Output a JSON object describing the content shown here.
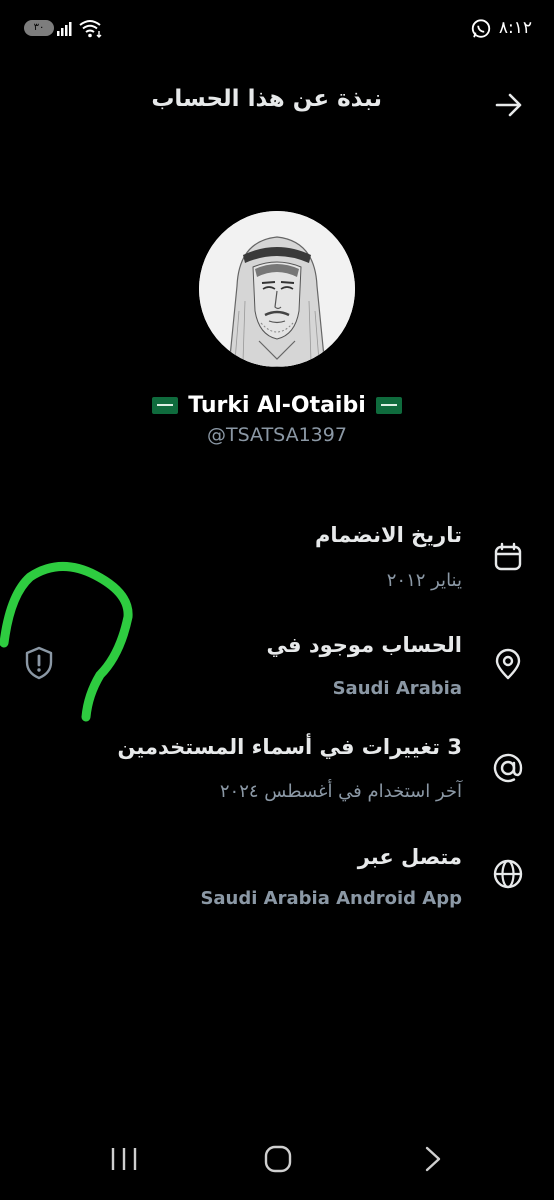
{
  "status_bar": {
    "time": "٨:١٢",
    "battery": "٣٠"
  },
  "header": {
    "title": "نبذة عن هذا الحساب"
  },
  "profile": {
    "display_name": "Turki Al-Otaibi",
    "handle": "@TSATSA1397"
  },
  "info": {
    "joined_label": "تاريخ الانضمام",
    "joined_value": "يناير ٢٠١٢",
    "location_label": "الحساب موجود في",
    "location_value": "Saudi Arabia",
    "username_changes_label": "3 تغييرات في أسماء المستخدمين",
    "username_changes_value": "آخر استخدام في أغسطس ٢٠٢٤",
    "connected_label": "متصل عبر",
    "connected_value": "Saudi Arabia Android App"
  },
  "colors": {
    "background": "#000000",
    "primary_text": "#e7e9ea",
    "secondary_text": "#8b98a5",
    "annotation_green": "#2ecc40"
  }
}
